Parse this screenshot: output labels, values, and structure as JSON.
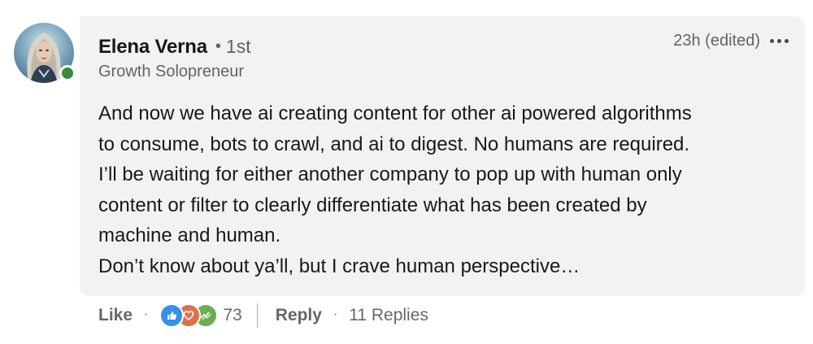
{
  "comment": {
    "author": {
      "name": "Elena Verna",
      "connection_degree": "1st",
      "headline": "Growth Solopreneur",
      "online": true
    },
    "timestamp": "23h (edited)",
    "body_lines": [
      "And now we have ai creating content for other ai powered algorithms",
      "to consume, bots to crawl, and ai to digest. No humans are required.",
      "I’ll be waiting for either another company to pop up with human only",
      "content or filter to clearly differentiate what has been created by",
      "machine and human.",
      "Don’t know about ya’ll, but I crave human perspective…"
    ]
  },
  "actions": {
    "like_label": "Like",
    "reaction_icons": [
      "like-reaction-icon",
      "love-reaction-icon",
      "support-reaction-icon"
    ],
    "reaction_count": "73",
    "reply_label": "Reply",
    "replies_label": "11 Replies"
  },
  "colors": {
    "bubble_bg": "#f2f2f2",
    "online_dot": "#3d8a3e",
    "like_blue": "#378fe9",
    "love_orange": "#df704d",
    "support_green": "#6dae4f"
  }
}
